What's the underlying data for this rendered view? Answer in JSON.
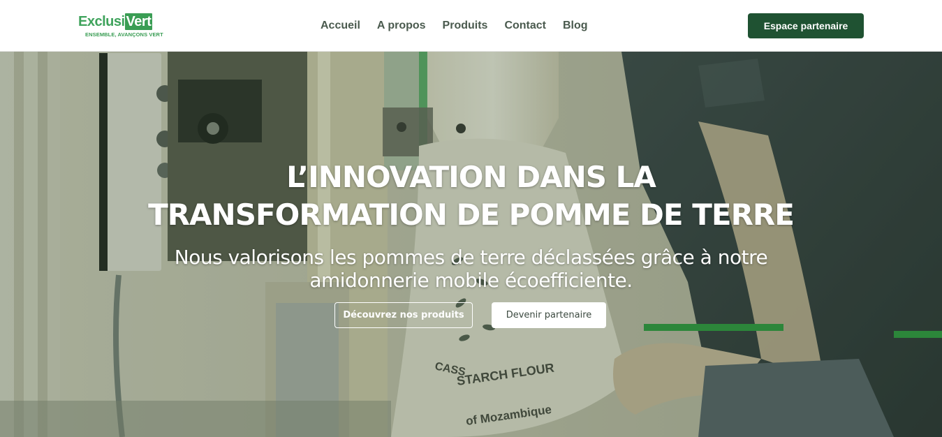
{
  "brand": {
    "logo_part1": "Exclusi",
    "logo_part2": "Vert",
    "tagline": "ENSEMBLE, AVANÇONS VERT",
    "color_primary": "#1f5232",
    "color_accent": "#3a9d54"
  },
  "nav": {
    "items": [
      {
        "label": "Accueil"
      },
      {
        "label": "A propos"
      },
      {
        "label": "Produits"
      },
      {
        "label": "Contact"
      },
      {
        "label": "Blog"
      }
    ],
    "cta_label": "Espace partenaire"
  },
  "hero": {
    "title_line1": "L’INNOVATION DANS LA",
    "title_line2": "TRANSFORMATION DE POMME DE TERRE",
    "subtitle_line1": "Nous valorisons les pommes de terre déclassées grâce à notre",
    "subtitle_line2": "amidonnerie mobile écoefficiente.",
    "btn_primary": "Découvrez nos produits",
    "btn_secondary": "Devenir partenaire",
    "bag_text_1": "CASS",
    "bag_text_2": "STARCH FLOUR",
    "bag_text_3": "of Mozambique"
  }
}
